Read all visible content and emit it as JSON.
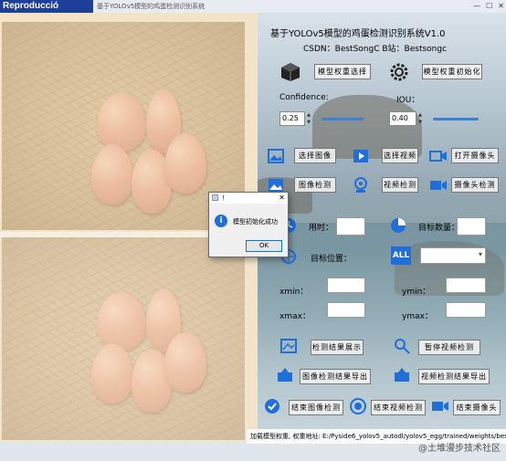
{
  "watermark": {
    "text": "Reproducció pausada"
  },
  "window": {
    "title_partial": "基于YOLOv5模型的鸡蛋检测识别系统",
    "min": "—",
    "max": "☐",
    "close": "✕"
  },
  "header": {
    "title": "基于YOLOv5模型的鸡蛋检测识别系统V1.0",
    "subtitle": "CSDN：BestSongC   B站：Bestsongc"
  },
  "model": {
    "select_label": "模型权重选择",
    "init_label": "模型权重初始化"
  },
  "confidence": {
    "label": "Confidence:",
    "value": "0.25",
    "fraction": 0.25
  },
  "iou": {
    "label": "IOU：",
    "value": "0.40",
    "fraction": 0.4
  },
  "buttons": {
    "select_image": "选择图像",
    "select_video": "选择视频",
    "open_camera": "打开摄像头",
    "image_detect": "图像检测",
    "video_detect": "视频检测",
    "camera_detect": "摄像头检测",
    "show_result": "检测结果展示",
    "pause_video": "暂停视频检测",
    "export_image": "图像检测结果导出",
    "export_video": "视频检测结果导出",
    "end_image": "结束图像检测",
    "end_video": "结束视频检测",
    "end_camera": "结束摄像头"
  },
  "stats": {
    "time_label": "用时：",
    "count_label": "目标数量：",
    "position_label": "目标位置：",
    "all_badge": "ALL",
    "xmin_label": "xmin：",
    "ymin_label": "ymin：",
    "xmax_label": "xmax：",
    "ymax_label": "ymax："
  },
  "dialog": {
    "title": "！",
    "message": "模型初始化成功",
    "ok": "OK"
  },
  "status_bar": {
    "text": "加载模型权重, 权重地址: E:/Pyside6_yolov5_autodl/yolov5_egg/trained/weights/best.pt"
  },
  "corner_watermark": "@土堆漫步技术社区",
  "colors": {
    "accent": "#3a7fd8",
    "watermark_bg": "#1d3f9a",
    "icon_blue": "#1e6fd9"
  }
}
